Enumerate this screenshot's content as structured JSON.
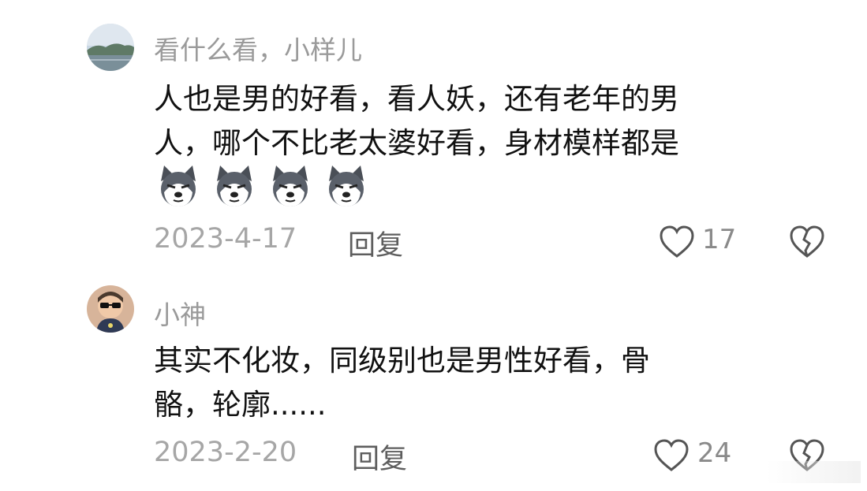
{
  "comments": [
    {
      "username": "看什么看，小样儿",
      "text_line1": "人也是男的好看，看人妖，还有老年的男",
      "text_line2": "人，哪个不比老太婆好看，身材模样都是",
      "emojis": [
        "husky-emoji-icon",
        "husky-emoji-icon",
        "husky-emoji-icon",
        "husky-emoji-icon"
      ],
      "date": "2023-4-17",
      "reply_label": "回复",
      "like_count": "17"
    },
    {
      "username": "小神",
      "text_line1": "其实不化妆，同级别也是男性好看，骨",
      "text_line2": "骼，轮廓......",
      "date": "2023-2-20",
      "reply_label": "回复",
      "like_count": "24"
    }
  ],
  "colors": {
    "username": "#9a9a9a",
    "text": "#111111",
    "meta": "#a6a6a6",
    "reply": "#5e5e5e"
  }
}
